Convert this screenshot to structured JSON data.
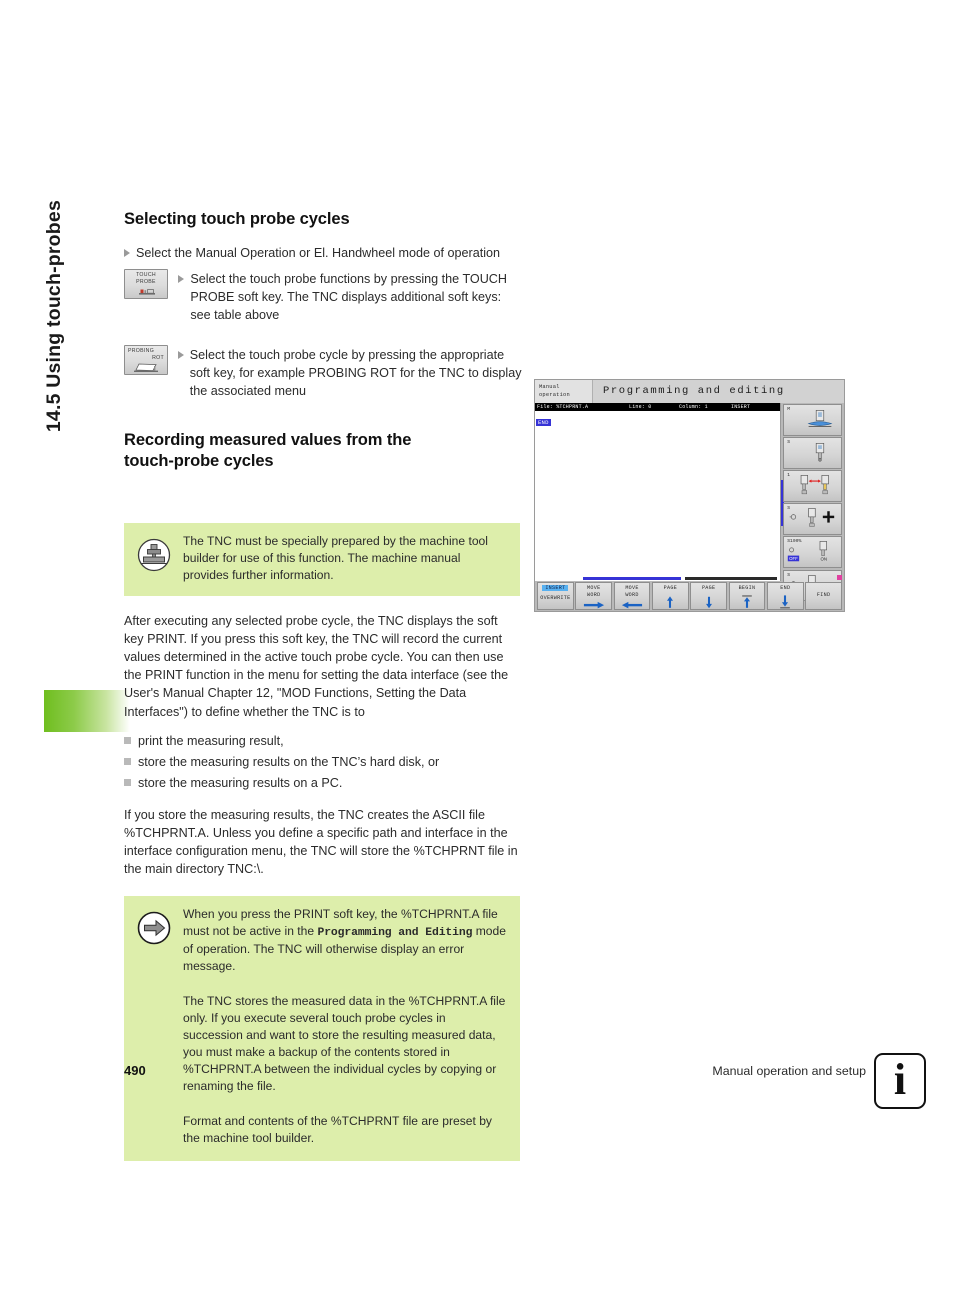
{
  "chapter": {
    "vertical_title": "14.5 Using touch-probes"
  },
  "sections": {
    "s1": {
      "heading": "Selecting touch probe cycles",
      "lead_bullet": "Select the Manual Operation or El. Handwheel mode of operation",
      "steps": [
        {
          "softkey_line1": "TOUCH",
          "softkey_line2": "PROBE",
          "softkey_icon": "touch-probe-icon",
          "text": "Select the touch probe functions by pressing the TOUCH PROBE soft key. The TNC displays additional soft keys: see table above"
        },
        {
          "softkey_line1": "PROBING",
          "softkey_line2": "ROT",
          "softkey_icon": "probing-rot-icon",
          "text": "Select the touch probe cycle by pressing the appropriate soft key, for example PROBING ROT for the TNC to display the associated menu"
        }
      ]
    },
    "s2": {
      "heading": "Recording measured values from the touch-probe cycles",
      "note_machine": {
        "icon": "machine-tool-builder-icon",
        "text": "The TNC must be specially prepared by the machine tool builder for use of this function. The machine manual provides further information."
      },
      "body_paragraph": "After executing any selected probe cycle, the TNC displays the soft key PRINT. If you press this soft key, the TNC will record the current values determined in the active touch probe cycle. You can then use the PRINT function in the menu for setting the data interface (see the User's Manual Chapter 12, \"MOD Functions, Setting the Data Interfaces\") to define whether the TNC is to",
      "bullets": [
        "print the measuring result,",
        "store the measuring results on the TNC’s hard disk, or",
        "store the measuring results on a PC."
      ],
      "after_bullets_paragraph": "If you store the measuring results, the TNC creates the ASCII file %TCHPRNT.A. Unless you define a specific path and interface in the interface configuration menu, the TNC will store the %TCHPRNT file in the main directory TNC:\\.",
      "note_print": {
        "icon": "arrow-right-icon",
        "para1_part1": "When you press the PRINT soft key, the %TCHPRNT.A file must not be active in the ",
        "para1_mono": "Programming and Editing",
        "para1_part2": " mode of operation. The TNC will otherwise display an error message.",
        "para2": "The TNC stores the measured data in the %TCHPRNT.A file only. If you execute several touch probe cycles in succession and want to store the resulting measured data, you must make a backup of the contents stored in %TCHPRNT.A between the individual cycles by copying or renaming the file.",
        "para3": "Format and contents of the %TCHPRNT file are preset by the machine tool builder."
      }
    }
  },
  "tnc_screen": {
    "mode_line1": "Manual",
    "mode_line2": "operation",
    "title": "Programming and editing",
    "editor_status": {
      "file": "File: %TCHPRNT.A",
      "line": "Line: 0",
      "column": "Column: 1",
      "mode": "INSERT"
    },
    "editor_first_line": "END",
    "vertical_softkeys": [
      {
        "label": "M",
        "icon": "probe-measure-icon"
      },
      {
        "label": "S",
        "icon": "probe-single-icon"
      },
      {
        "label": "1",
        "icon": "probe-distance-icon"
      },
      {
        "label": "S",
        "icon": "probe-plus-icon"
      },
      {
        "label": "S100%",
        "icon": "probe-toggle-icon",
        "off": "OFF",
        "on": "ON"
      },
      {
        "label": "S",
        "icon": "probe-minus-icon"
      }
    ],
    "horizontal_softkeys": [
      {
        "line1": "INSERT",
        "line2": "OVERWRITE",
        "highlight": true
      },
      {
        "line1": "MOVE",
        "line2": "WORD",
        "glyph": "arrow-right-icon"
      },
      {
        "line1": "MOVE",
        "line2": "WORD",
        "glyph": "arrow-left-icon"
      },
      {
        "line1": "PAGE",
        "line2": "",
        "glyph": "arrow-up-icon"
      },
      {
        "line1": "PAGE",
        "line2": "",
        "glyph": "arrow-down-icon"
      },
      {
        "line1": "BEGIN",
        "line2": "",
        "glyph": "arrow-up-bar-icon"
      },
      {
        "line1": "END",
        "line2": "",
        "glyph": "arrow-down-bar-icon"
      },
      {
        "line1": "FIND",
        "line2": "",
        "glyph": ""
      }
    ]
  },
  "footer": {
    "page_number": "490",
    "title": "Manual operation and setup",
    "badge_char": "i"
  },
  "colors": {
    "note_green": "#ddeeab",
    "tab_green": "#6fbe1f",
    "tnc_blue": "#3633d6",
    "softkey_highlight": "#57b0f0"
  }
}
